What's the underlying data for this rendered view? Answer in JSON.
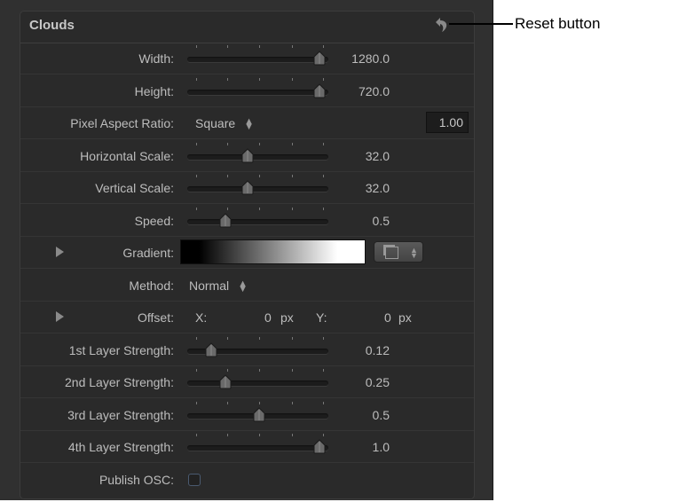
{
  "panel": {
    "title": "Clouds",
    "reset_icon": "reset-arrow-icon",
    "rows": [
      {
        "type": "slider",
        "label": "Width:",
        "value": "1280.0",
        "position": 0.94
      },
      {
        "type": "slider",
        "label": "Height:",
        "value": "720.0",
        "position": 0.94
      },
      {
        "type": "popup",
        "label": "Pixel Aspect Ratio:",
        "value": "Square",
        "box": "1.00"
      },
      {
        "type": "slider",
        "label": "Horizontal Scale:",
        "value": "32.0",
        "position": 0.43
      },
      {
        "type": "slider",
        "label": "Vertical Scale:",
        "value": "32.0",
        "position": 0.43
      },
      {
        "type": "slider",
        "label": "Speed:",
        "value": "0.5",
        "position": 0.27
      },
      {
        "type": "gradient",
        "label": "Gradient:"
      },
      {
        "type": "popup",
        "label": "Method:",
        "value": "Normal"
      },
      {
        "type": "offset",
        "label": "Offset:",
        "x_label": "X:",
        "x_value": "0",
        "y_label": "Y:",
        "y_value": "0",
        "unit": "px"
      },
      {
        "type": "slider",
        "label": "1st Layer Strength:",
        "value": "0.12",
        "position": 0.17
      },
      {
        "type": "slider",
        "label": "2nd Layer Strength:",
        "value": "0.25",
        "position": 0.27
      },
      {
        "type": "slider",
        "label": "3rd Layer Strength:",
        "value": "0.5",
        "position": 0.51
      },
      {
        "type": "slider",
        "label": "4th Layer Strength:",
        "value": "1.0",
        "position": 0.94
      },
      {
        "type": "checkbox",
        "label": "Publish OSC:",
        "checked": false
      }
    ]
  },
  "annotation": {
    "text": "Reset button"
  }
}
